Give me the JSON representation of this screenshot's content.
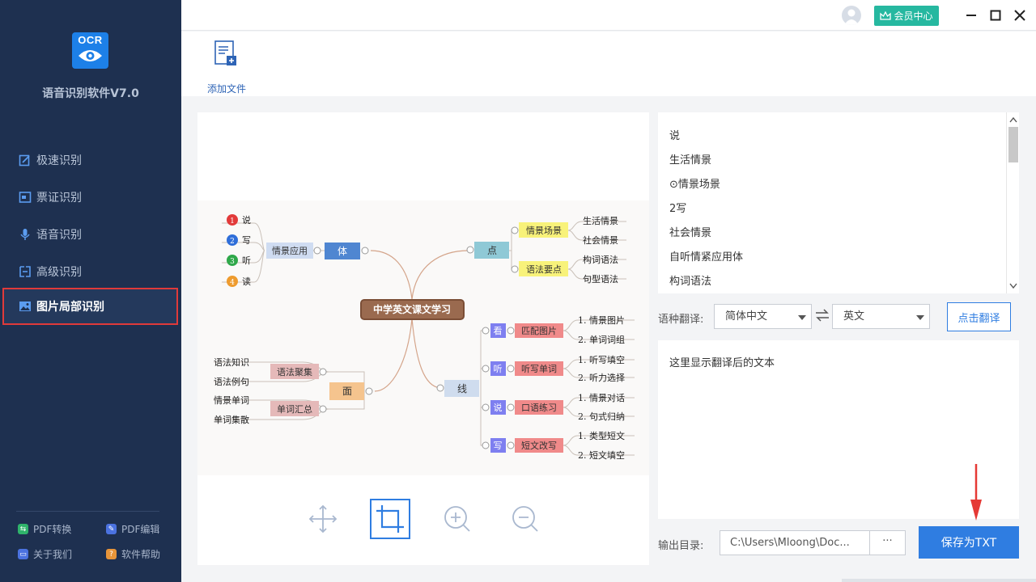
{
  "app": {
    "logo_text": "OCR",
    "name": "语音识别软件V7.0"
  },
  "nav": {
    "items": [
      {
        "label": "极速识别",
        "icon": "fast-recognize-icon"
      },
      {
        "label": "票证识别",
        "icon": "ticket-icon"
      },
      {
        "label": "语音识别",
        "icon": "microphone-icon"
      },
      {
        "label": "高级识别",
        "icon": "advanced-icon"
      },
      {
        "label": "图片局部识别",
        "icon": "image-icon",
        "active": true
      }
    ],
    "bottom_links": [
      {
        "label": "PDF转换",
        "icon": "pdf-convert-icon",
        "color": "#2fb36b"
      },
      {
        "label": "PDF编辑",
        "icon": "pdf-edit-icon",
        "color": "#4b72e0"
      },
      {
        "label": "关于我们",
        "icon": "about-icon",
        "color": "#4b72e0"
      },
      {
        "label": "软件帮助",
        "icon": "help-icon",
        "color": "#e8953a"
      }
    ]
  },
  "topbar": {
    "vip_label": "会员中心"
  },
  "toolbar": {
    "add_file_label": "添加文件"
  },
  "mindmap": {
    "center": "中学英文课文学习",
    "left_top": {
      "branch": "体",
      "sub": "情景应用",
      "leaves": [
        "说",
        "写",
        "听",
        "读"
      ],
      "leaf_nums": [
        "1",
        "2",
        "3",
        "4"
      ]
    },
    "left_bottom": {
      "branch": "面",
      "subs": [
        "语法聚集",
        "单词汇总"
      ],
      "leaves": [
        "语法知识",
        "语法例句",
        "情景单词",
        "单词集散"
      ]
    },
    "right_top": {
      "branch": "点",
      "subs": [
        "情景场景",
        "语法要点"
      ],
      "leaves": [
        "生活情景",
        "社会情景",
        "构词语法",
        "句型语法"
      ]
    },
    "right_bottom": {
      "branch": "线",
      "groups": [
        {
          "tag": "看",
          "sub": "匹配图片",
          "leaves": [
            "1. 情景图片",
            "2. 单词词组"
          ]
        },
        {
          "tag": "听",
          "sub": "听写单词",
          "leaves": [
            "1. 听写填空",
            "2. 听力选择"
          ]
        },
        {
          "tag": "说",
          "sub": "口语练习",
          "leaves": [
            "1. 情景对话",
            "2. 句式归纳"
          ]
        },
        {
          "tag": "写",
          "sub": "短文改写",
          "leaves": [
            "1. 类型短文",
            "2. 短文填空"
          ]
        }
      ]
    }
  },
  "result": {
    "lines": [
      "说",
      "生活情景",
      "⊙情景场景",
      "2写",
      "社会情景",
      "自听情紧应用体",
      "构词语法"
    ]
  },
  "translate": {
    "label": "语种翻译:",
    "source": "简体中文",
    "target": "英文",
    "button": "点击翻译",
    "placeholder": "这里显示翻译后的文本"
  },
  "output": {
    "label": "输出目录:",
    "path": "C:\\Users\\Mloong\\Doc...",
    "browse": "···",
    "save_button": "保存为TXT"
  }
}
